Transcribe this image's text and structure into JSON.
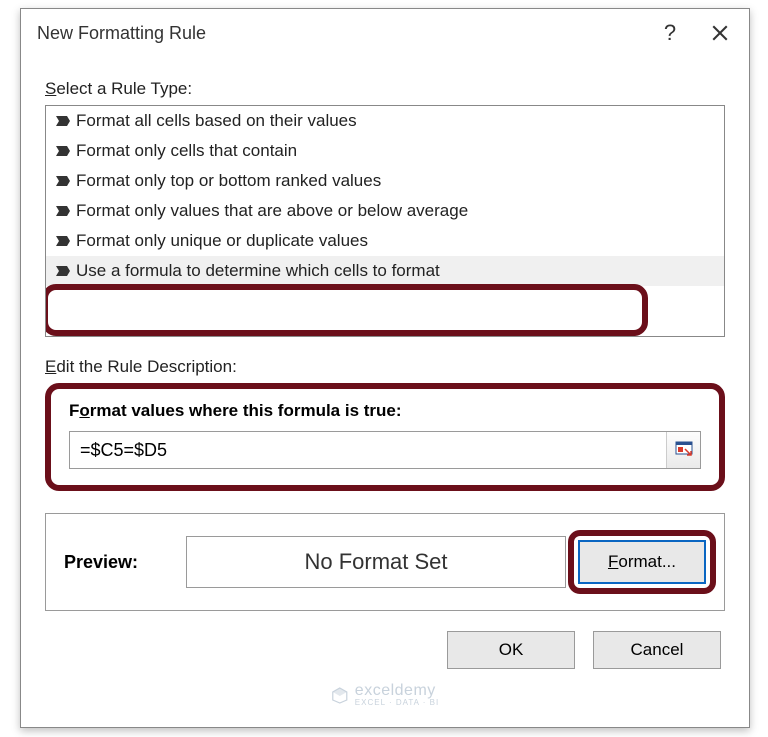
{
  "title": "New Formatting Rule",
  "select_label_pre": "S",
  "select_label_rest": "elect a Rule Type:",
  "rules": [
    "Format all cells based on their values",
    "Format only cells that contain",
    "Format only top or bottom ranked values",
    "Format only values that are above or below average",
    "Format only unique or duplicate values",
    "Use a formula to determine which cells to format"
  ],
  "edit_label_pre": "E",
  "edit_label_rest": "dit the Rule Description:",
  "formula_label_pre": "F",
  "formula_label_mid": "o",
  "formula_label_rest": "rmat values where this formula is true:",
  "formula_value": "=$C5=$D5",
  "preview_label": "Preview:",
  "preview_text": "No Format Set",
  "format_btn_pre": "F",
  "format_btn_rest": "ormat...",
  "ok_label": "OK",
  "cancel_label": "Cancel",
  "watermark_main": "exceldemy",
  "watermark_sub": "EXCEL · DATA · BI"
}
